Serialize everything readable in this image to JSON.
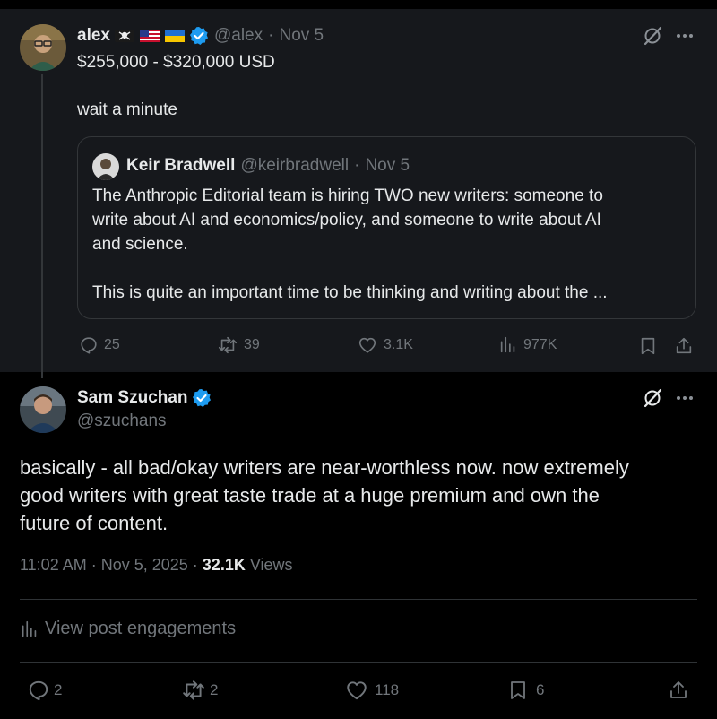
{
  "parent_post": {
    "author_name": "alex",
    "author_handle": "@alex",
    "date": "Nov 5",
    "text_line1": "$255,000 - $320,000 USD",
    "text_line2": "wait a minute",
    "badges": [
      "pirate-flag-emoji",
      "us-flag-emoji",
      "ukraine-flag-emoji",
      "verified-badge"
    ],
    "quoted": {
      "author_name": "Keir Bradwell",
      "author_handle": "@keirbradwell",
      "date": "Nov 5",
      "line1": "The Anthropic Editorial team is hiring TWO new writers: someone to",
      "line2": "write about AI and economics/policy, and someone to write about AI",
      "line3": "and science.",
      "line4": "This is quite an important time to be thinking and writing about the ..."
    },
    "stats": {
      "replies": "25",
      "reposts": "39",
      "likes": "3.1K",
      "views": "977K"
    }
  },
  "main_post": {
    "author_name": "Sam Szuchan",
    "author_handle": "@szuchans",
    "line1": "basically - all bad/okay writers are near-worthless now. now extremely",
    "line2": "good writers with great taste trade at a huge premium and own the",
    "line3": "future of content.",
    "timestamp": "11:02 AM · Nov 5, 2025",
    "views_count": "32.1K",
    "views_label": "Views",
    "engagements_label": "View post engagements",
    "stats": {
      "replies": "2",
      "reposts": "2",
      "likes": "118",
      "bookmarks": "6"
    }
  },
  "colors": {
    "background": "#000000",
    "card": "#16181c",
    "text": "#e7e9ea",
    "muted": "#71767b",
    "verified": "#1d9bf0",
    "border": "#333639"
  }
}
